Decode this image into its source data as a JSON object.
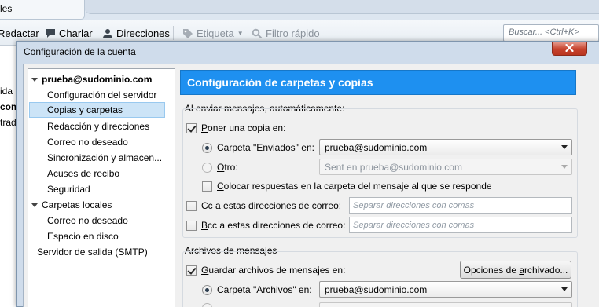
{
  "background": {
    "tab_label": "les",
    "toolbar": {
      "write": "Redactar",
      "chat": "Charlar",
      "addresses": "Direcciones",
      "tag": "Etiqueta",
      "quick_filter": "Filtro rápido"
    },
    "search_placeholder": "Buscar... <Ctrl+K>",
    "sidebar_fragments": [
      "ida",
      "com",
      "trada"
    ]
  },
  "dialog": {
    "title": "Configuración de la cuenta",
    "tree": {
      "account": "prueba@sudominio.com",
      "account_items": [
        "Configuración del servidor",
        "Copias y carpetas",
        "Redacción y direcciones",
        "Correo no deseado",
        "Sincronización y almacen...",
        "Acuses de recibo",
        "Seguridad"
      ],
      "local_folders": "Carpetas locales",
      "local_items": [
        "Correo no deseado",
        "Espacio en disco"
      ],
      "smtp": "Servidor de salida (SMTP)"
    },
    "page": {
      "header": "Configuración de carpetas y copias",
      "sending": {
        "group_label": "Al enviar mensajes, automáticamente:",
        "copy_checkbox": {
          "pre": "",
          "u": "P",
          "post": "oner una copia en:",
          "checked": true
        },
        "sent_radio": {
          "pre": "Carpeta \"",
          "u": "E",
          "post": "nviados\" en:",
          "checked": true
        },
        "sent_select": "prueba@sudominio.com",
        "other_radio": {
          "pre": "",
          "u": "O",
          "post": "tro:",
          "checked": false
        },
        "other_select": "Sent en prueba@sudominio.com",
        "reply_checkbox": {
          "pre": "",
          "u": "C",
          "post": "olocar respuestas en la carpeta del mensaje al que se responde",
          "checked": false
        },
        "cc_checkbox": {
          "pre": "",
          "u": "C",
          "post": "c a estas direcciones de correo:",
          "checked": false
        },
        "cc_placeholder": "Separar direcciones con comas",
        "bcc_checkbox": {
          "pre": "",
          "u": "B",
          "post": "cc a estas direcciones de correo:",
          "checked": false
        },
        "bcc_placeholder": "Separar direcciones con comas"
      },
      "archives": {
        "group_label": "Archivos de mensajes",
        "keep_checkbox": {
          "pre": "",
          "u": "G",
          "post": "uardar archivos de mensajes en:",
          "checked": true
        },
        "options_button": {
          "pre": "Opciones de ",
          "u": "a",
          "post": "rchivado..."
        },
        "archives_radio": {
          "pre": "Carpeta \"",
          "u": "A",
          "post": "rchivos\" en:",
          "checked": true
        },
        "archives_select": "prueba@sudominio.com"
      }
    }
  },
  "colors": {
    "header_blue": "#1e90f0",
    "close_red": "#c7432e",
    "selection": "#cce4f7"
  }
}
